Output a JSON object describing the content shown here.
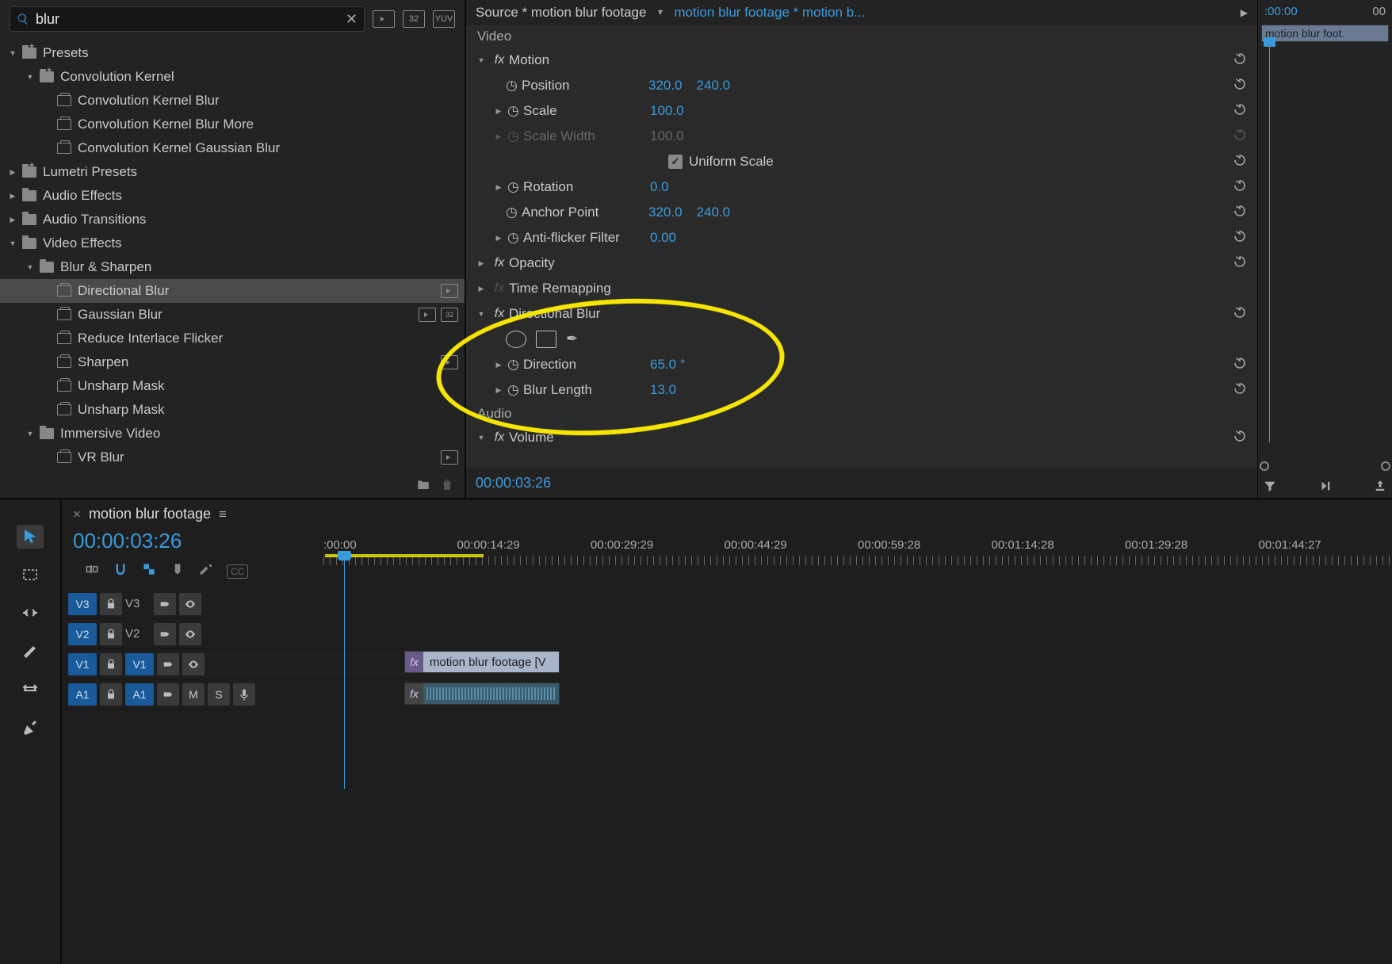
{
  "search": {
    "value": "blur"
  },
  "badges": {
    "b1": "▶",
    "b2": "32",
    "b3": "YUV"
  },
  "tree": {
    "presets": "Presets",
    "convKernel": "Convolution Kernel",
    "convBlur": "Convolution Kernel Blur",
    "convBlurMore": "Convolution Kernel Blur More",
    "convGauss": "Convolution Kernel Gaussian Blur",
    "lumetri": "Lumetri Presets",
    "audioEffects": "Audio Effects",
    "audioTransitions": "Audio Transitions",
    "videoEffects": "Video Effects",
    "blurSharpen": "Blur & Sharpen",
    "directionalBlur": "Directional Blur",
    "gaussianBlur": "Gaussian Blur",
    "reduceInterlace": "Reduce Interlace Flicker",
    "sharpen": "Sharpen",
    "unsharpMask": "Unsharp Mask",
    "unsharpMask2": "Unsharp Mask",
    "immersive": "Immersive Video",
    "vrBlur": "VR Blur"
  },
  "ec": {
    "source": "Source * motion blur footage",
    "sequence": "motion blur footage * motion b...",
    "video": "Video",
    "motion": "Motion",
    "position": "Position",
    "posX": "320.0",
    "posY": "240.0",
    "scale": "Scale",
    "scaleV": "100.0",
    "scaleWidth": "Scale Width",
    "scaleWV": "100.0",
    "uniform": "Uniform Scale",
    "rotation": "Rotation",
    "rotV": "0.0",
    "anchor": "Anchor Point",
    "anX": "320.0",
    "anY": "240.0",
    "antiflicker": "Anti-flicker Filter",
    "afV": "0.00",
    "opacity": "Opacity",
    "timeRemap": "Time Remapping",
    "dirBlur": "Directional Blur",
    "direction": "Direction",
    "dirV": "65.0 °",
    "blurLength": "Blur Length",
    "blV": "13.0",
    "audio": "Audio",
    "volume": "Volume",
    "timecode": "00:00:03:26",
    "miniTc1": ":00:00",
    "miniTc2": "00",
    "miniClip": "motion blur foot."
  },
  "tl": {
    "seqName": "motion blur footage",
    "tc": "00:00:03:26",
    "ruler": [
      ":00:00",
      "00:00:14:29",
      "00:00:29:29",
      "00:00:44:29",
      "00:00:59:28",
      "00:01:14:28",
      "00:01:29:28",
      "00:01:44:27"
    ],
    "tracks": {
      "v3": "V3",
      "v2": "V2",
      "v1": "V1",
      "a1": "A1",
      "m": "M",
      "s": "S"
    },
    "clipName": "motion blur footage [V"
  }
}
